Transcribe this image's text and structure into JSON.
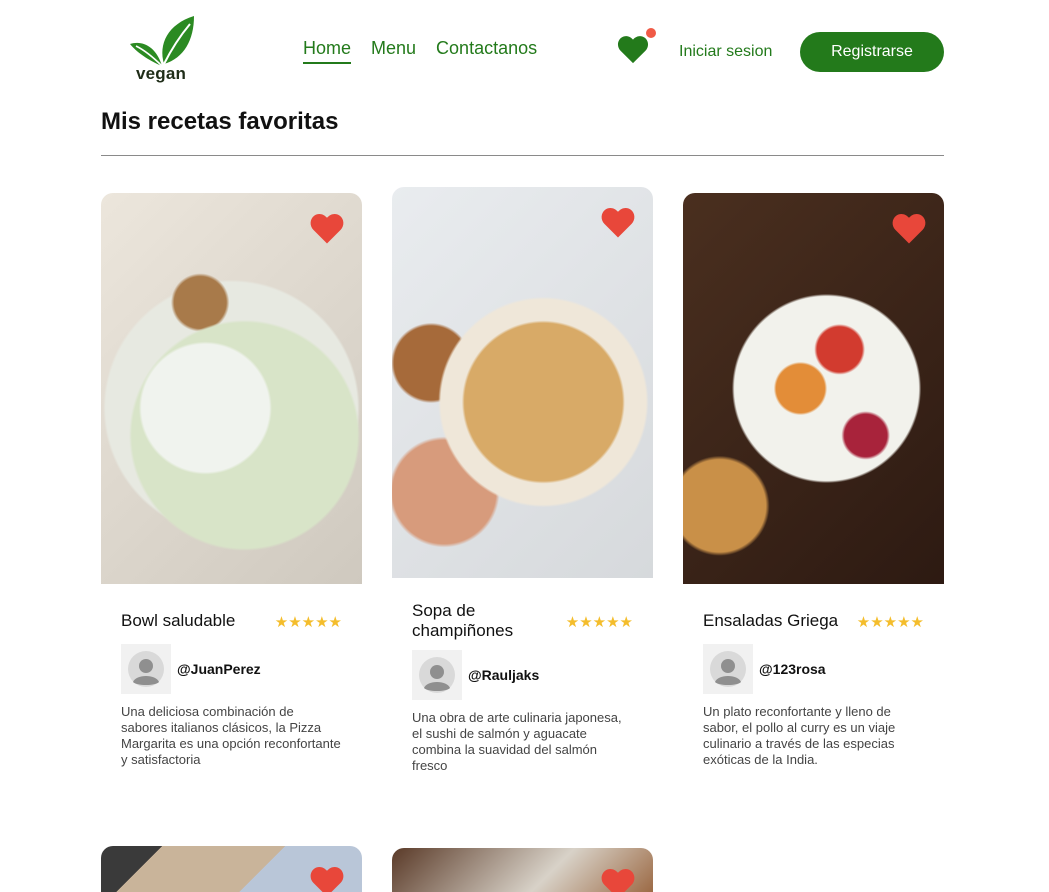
{
  "header": {
    "logo_text": "vegan",
    "nav": [
      {
        "label": "Home",
        "active": true
      },
      {
        "label": "Menu",
        "active": false
      },
      {
        "label": "Contactanos",
        "active": false
      }
    ],
    "login_label": "Iniciar sesion",
    "register_label": "Registrarse"
  },
  "page_title": "Mis recetas favoritas",
  "colors": {
    "brand_green": "#237a1b",
    "heart_red": "#e8473a",
    "star_yellow": "#f4bd2c",
    "notification_dot": "#f05a46"
  },
  "recipes": [
    {
      "title": "Bowl saludable",
      "rating": 5,
      "stars": "★★★★★",
      "author": "@JuanPerez",
      "description": "Una deliciosa combinación de sabores italianos clásicos, la Pizza Margarita es una opción reconfortante y satisfactoria"
    },
    {
      "title": "Sopa de champiñones",
      "rating": 5,
      "stars": "★★★★★",
      "author": "@Rauljaks",
      "description": "Una obra de arte culinaria japonesa, el sushi de salmón y aguacate combina la suavidad del salmón fresco"
    },
    {
      "title": "Ensaladas Griega",
      "rating": 5,
      "stars": "★★★★★",
      "author": "@123rosa",
      "description": "Un plato reconfortante y lleno de sabor, el pollo al curry es un viaje culinario a través de las especias exóticas de la India."
    }
  ]
}
